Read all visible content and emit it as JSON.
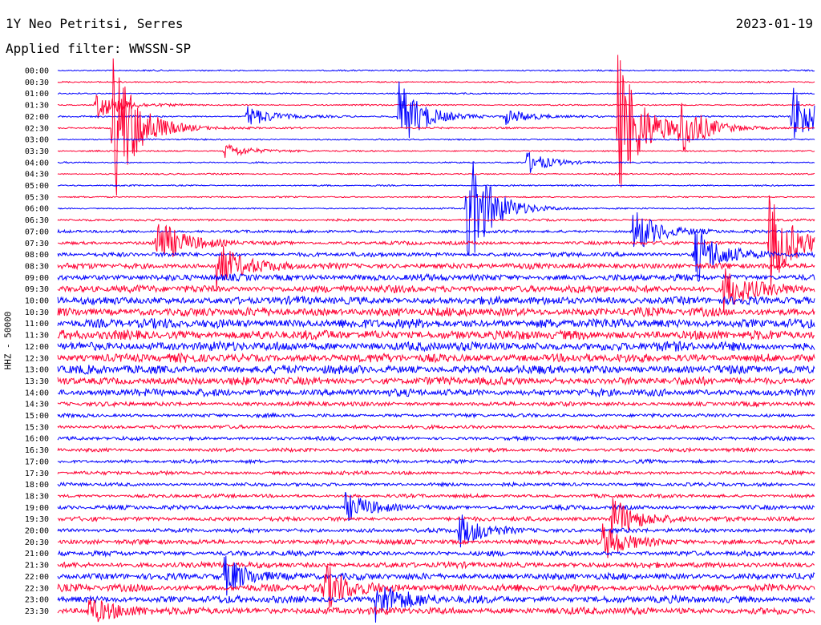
{
  "header": {
    "station": "1Y Neo Petritsi, Serres",
    "date": "2023-01-19",
    "filter_text": "Applied filter: WWSSN-SP",
    "channel_label": "HHZ - 50000"
  },
  "chart_data": {
    "type": "line",
    "title": "1Y Neo Petritsi, Serres",
    "subtitle": "Applied filter: WWSSN-SP",
    "ylabel": "HHZ - 50000",
    "row_labels": [
      "00:00",
      "00:30",
      "01:00",
      "01:30",
      "02:00",
      "02:30",
      "03:00",
      "03:30",
      "04:00",
      "04:30",
      "05:00",
      "05:30",
      "06:00",
      "06:30",
      "07:00",
      "07:30",
      "08:00",
      "08:30",
      "09:00",
      "09:30",
      "10:00",
      "10:30",
      "11:00",
      "11:30",
      "12:00",
      "12:30",
      "13:00",
      "13:30",
      "14:00",
      "14:30",
      "15:00",
      "15:30",
      "16:00",
      "16:30",
      "17:00",
      "17:30",
      "18:00",
      "18:30",
      "19:00",
      "19:30",
      "20:00",
      "20:30",
      "21:00",
      "21:30",
      "22:00",
      "22:30",
      "23:00",
      "23:30"
    ],
    "trace_colors": [
      "#0000ff",
      "#ff0033"
    ],
    "row_noise_level": [
      1,
      1,
      1,
      1,
      1.2,
      1.2,
      1,
      1,
      1,
      1,
      1,
      1,
      1,
      1.5,
      2,
      2.5,
      3,
      4,
      4.5,
      5,
      5.5,
      6,
      6.5,
      6.5,
      6.5,
      6,
      6,
      5.5,
      5,
      3,
      2.5,
      2.5,
      2.5,
      2.5,
      2.5,
      2.5,
      2.5,
      2.5,
      3,
      3,
      3,
      3.5,
      3.5,
      4,
      4.5,
      5,
      5,
      5
    ],
    "events": [
      {
        "row": 3,
        "x_frac": 0.05,
        "amplitude": 18
      },
      {
        "row": 4,
        "x_frac": 0.25,
        "amplitude": 14
      },
      {
        "row": 4,
        "x_frac": 0.59,
        "amplitude": 10
      },
      {
        "row": 4,
        "x_frac": 0.45,
        "amplitude": 45
      },
      {
        "row": 5,
        "x_frac": 0.073,
        "amplitude": 100
      },
      {
        "row": 5,
        "x_frac": 0.74,
        "amplitude": 95
      },
      {
        "row": 5,
        "x_frac": 0.82,
        "amplitude": 35
      },
      {
        "row": 4,
        "x_frac": 0.97,
        "amplitude": 40
      },
      {
        "row": 7,
        "x_frac": 0.22,
        "amplitude": 10
      },
      {
        "row": 8,
        "x_frac": 0.62,
        "amplitude": 14
      },
      {
        "row": 12,
        "x_frac": 0.54,
        "amplitude": 80
      },
      {
        "row": 14,
        "x_frac": 0.76,
        "amplitude": 30
      },
      {
        "row": 15,
        "x_frac": 0.13,
        "amplitude": 35
      },
      {
        "row": 15,
        "x_frac": 0.94,
        "amplitude": 60
      },
      {
        "row": 16,
        "x_frac": 0.84,
        "amplitude": 40
      },
      {
        "row": 17,
        "x_frac": 0.21,
        "amplitude": 30
      },
      {
        "row": 19,
        "x_frac": 0.88,
        "amplitude": 28
      },
      {
        "row": 38,
        "x_frac": 0.38,
        "amplitude": 18
      },
      {
        "row": 39,
        "x_frac": 0.73,
        "amplitude": 30
      },
      {
        "row": 40,
        "x_frac": 0.53,
        "amplitude": 22
      },
      {
        "row": 41,
        "x_frac": 0.72,
        "amplitude": 22
      },
      {
        "row": 44,
        "x_frac": 0.22,
        "amplitude": 24
      },
      {
        "row": 45,
        "x_frac": 0.35,
        "amplitude": 30
      },
      {
        "row": 46,
        "x_frac": 0.42,
        "amplitude": 26
      },
      {
        "row": 47,
        "x_frac": 0.04,
        "amplitude": 18
      }
    ]
  }
}
